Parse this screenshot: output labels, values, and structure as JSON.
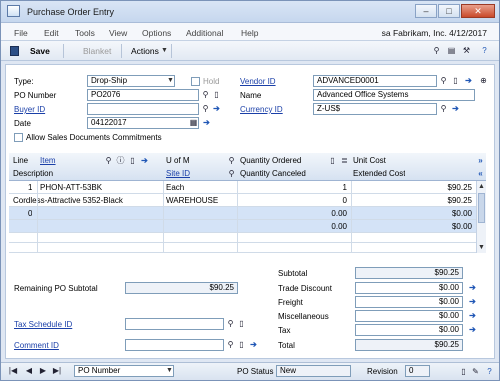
{
  "window": {
    "title": "Purchase Order Entry"
  },
  "menu": [
    "File",
    "Edit",
    "Tools",
    "View",
    "Options",
    "Additional",
    "Help"
  ],
  "company": "sa  Fabrikam, Inc.  4/12/2017",
  "toolbar": {
    "save": "Save",
    "blanket": "Blanket",
    "actions": "Actions"
  },
  "header": {
    "type_label": "Type:",
    "type_value": "Drop-Ship",
    "hold_label": "Hold",
    "po_number_label": "PO Number",
    "po_number_value": "PO2076",
    "buyer_id_label": "Buyer ID",
    "buyer_id_value": "",
    "date_label": "Date",
    "date_value": "04122017",
    "allow_commitments_label": "Allow Sales Documents Commitments",
    "vendor_id_label": "Vendor ID",
    "vendor_id_value": "ADVANCED0001",
    "name_label": "Name",
    "name_value": "Advanced Office Systems",
    "currency_id_label": "Currency ID",
    "currency_id_value": "Z-US$"
  },
  "grid": {
    "headers_row1": {
      "line": "Line",
      "item": "Item",
      "uofm": "U of M",
      "qty_ordered": "Quantity Ordered",
      "unit_cost": "Unit Cost"
    },
    "headers_row2": {
      "description": "Description",
      "site_id": "Site ID",
      "qty_canceled": "Quantity Canceled",
      "extended_cost": "Extended Cost"
    },
    "rows": [
      {
        "line": "1",
        "item": "PHON-ATT-53BK",
        "uofm": "Each",
        "qty": "1",
        "cost": "$90.25"
      },
      {
        "line": "",
        "item": "Cordless-Attractive 5352-Black",
        "uofm": "WAREHOUSE",
        "qty": "0",
        "cost": "$90.25"
      },
      {
        "line": "0",
        "item": "",
        "uofm": "",
        "qty": "0.00",
        "cost": "$0.00"
      },
      {
        "line": "",
        "item": "",
        "uofm": "",
        "qty": "0.00",
        "cost": "$0.00"
      },
      {
        "line": "",
        "item": "",
        "uofm": "",
        "qty": "",
        "cost": ""
      },
      {
        "line": "",
        "item": "",
        "uofm": "",
        "qty": "",
        "cost": ""
      }
    ]
  },
  "totals": {
    "remaining_label": "Remaining PO Subtotal",
    "remaining_value": "$90.25",
    "subtotal_label": "Subtotal",
    "subtotal_value": "$90.25",
    "trade_discount_label": "Trade Discount",
    "trade_discount_value": "$0.00",
    "freight_label": "Freight",
    "freight_value": "$0.00",
    "misc_label": "Miscellaneous",
    "misc_value": "$0.00",
    "tax_label": "Tax",
    "tax_value": "$0.00",
    "total_label": "Total",
    "total_value": "$90.25",
    "tax_schedule_label": "Tax Schedule ID",
    "tax_schedule_value": "",
    "comment_id_label": "Comment ID",
    "comment_id_value": ""
  },
  "status": {
    "sort_value": "PO Number",
    "po_status_label": "PO Status",
    "po_status_value": "New",
    "revision_label": "Revision",
    "revision_value": "0"
  }
}
